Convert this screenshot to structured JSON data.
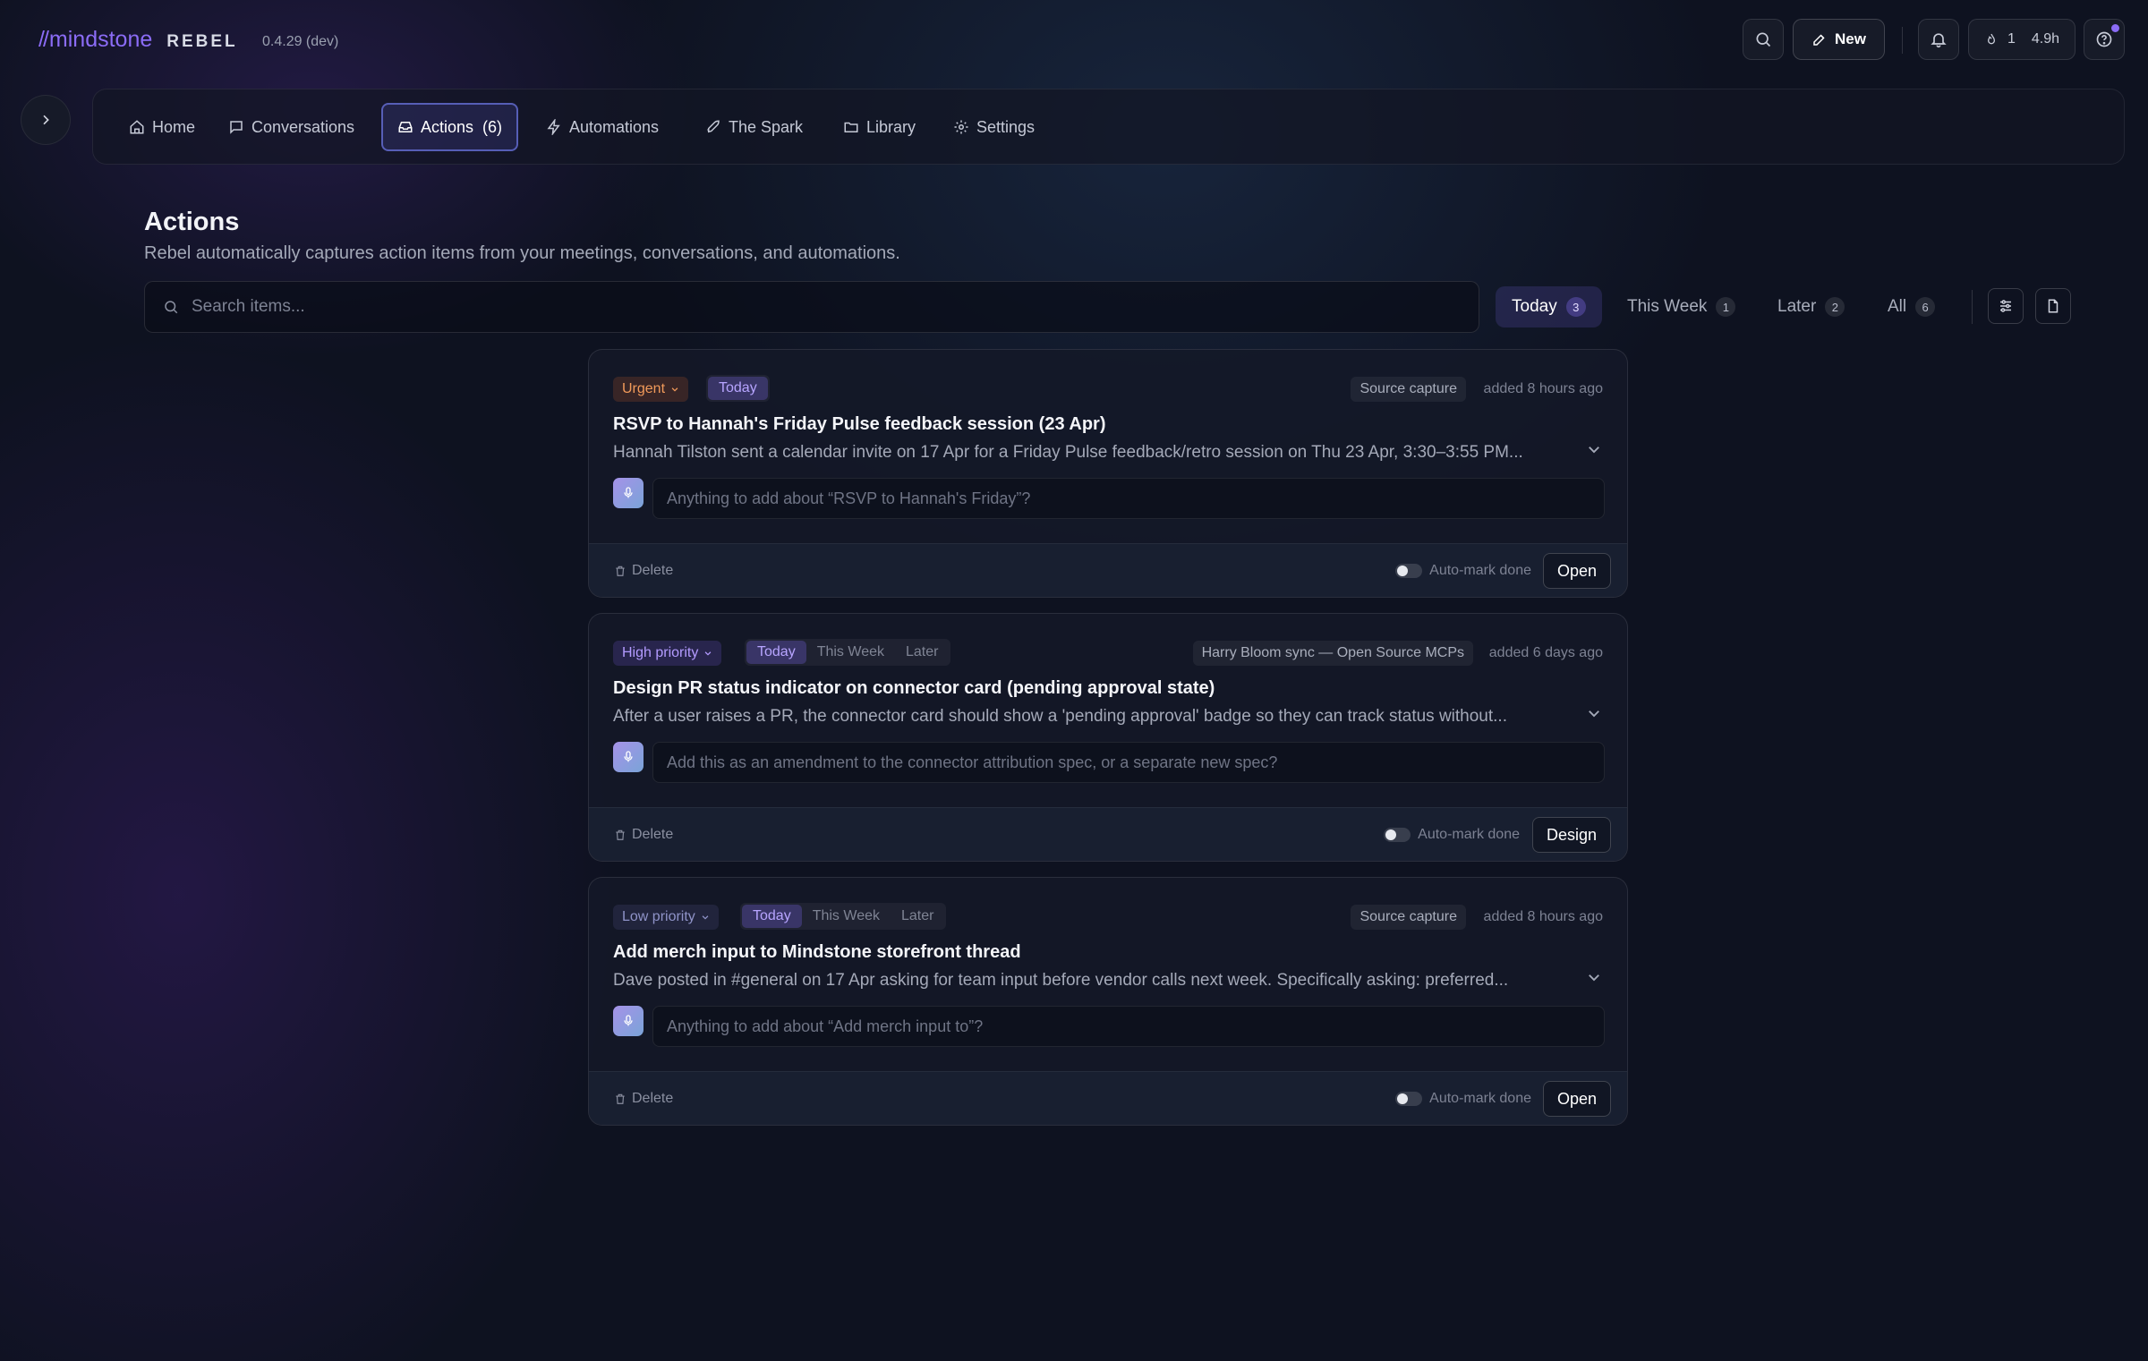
{
  "app": {
    "brand_slashes": "//",
    "brand_name": "mindstone",
    "brand_product": "REBEL",
    "version": "0.4.29 (dev)"
  },
  "topbar": {
    "new_label": "New",
    "streak_count": "1",
    "hours": "4.9h"
  },
  "nav": {
    "items": [
      {
        "label": "Home",
        "icon": "home-icon"
      },
      {
        "label": "Conversations",
        "icon": "chat-icon"
      },
      {
        "label": "Actions  (6)",
        "icon": "inbox-icon"
      },
      {
        "label": "Automations",
        "icon": "bolt-icon"
      },
      {
        "label": "The Spark",
        "icon": "rocket-icon"
      },
      {
        "label": "Library",
        "icon": "folder-icon"
      },
      {
        "label": "Settings",
        "icon": "gear-icon"
      }
    ],
    "active_index": 2
  },
  "page": {
    "title": "Actions",
    "subtitle": "Rebel automatically captures action items from your meetings, conversations, and automations.",
    "search_placeholder": "Search items..."
  },
  "filters": [
    {
      "label": "Today",
      "count": "3"
    },
    {
      "label": "This Week",
      "count": "1"
    },
    {
      "label": "Later",
      "count": "2"
    },
    {
      "label": "All",
      "count": "6"
    }
  ],
  "cards": [
    {
      "priority": "Urgent",
      "when": [
        "Today"
      ],
      "source": "Source capture",
      "added": "added 8 hours ago",
      "title": "RSVP to Hannah's Friday Pulse feedback session (23 Apr)",
      "desc": "Hannah Tilston sent a calendar invite on 17 Apr for a Friday Pulse feedback/retro session on Thu 23 Apr, 3:30–3:55 PM...",
      "placeholder": "Anything to add about “RSVP to Hannah's Friday”?",
      "delete": "Delete",
      "automark": "Auto-mark done",
      "action": "Open"
    },
    {
      "priority": "High priority",
      "when": [
        "Today",
        "This Week",
        "Later"
      ],
      "source": "Harry Bloom sync — Open Source MCPs",
      "added": "added 6 days ago",
      "title": "Design PR status indicator on connector card (pending approval state)",
      "desc": "After a user raises a PR, the connector card should show a 'pending approval' badge so they can track status without...",
      "placeholder": "Add this as an amendment to the connector attribution spec, or a separate new spec?",
      "delete": "Delete",
      "automark": "Auto-mark done",
      "action": "Design"
    },
    {
      "priority": "Low priority",
      "when": [
        "Today",
        "This Week",
        "Later"
      ],
      "source": "Source capture",
      "added": "added 8 hours ago",
      "title": "Add merch input to Mindstone storefront thread",
      "desc": "Dave posted in #general on 17 Apr asking for team input before vendor calls next week. Specifically asking: preferred...",
      "placeholder": "Anything to add about “Add merch input to”?",
      "delete": "Delete",
      "automark": "Auto-mark done",
      "action": "Open"
    }
  ]
}
